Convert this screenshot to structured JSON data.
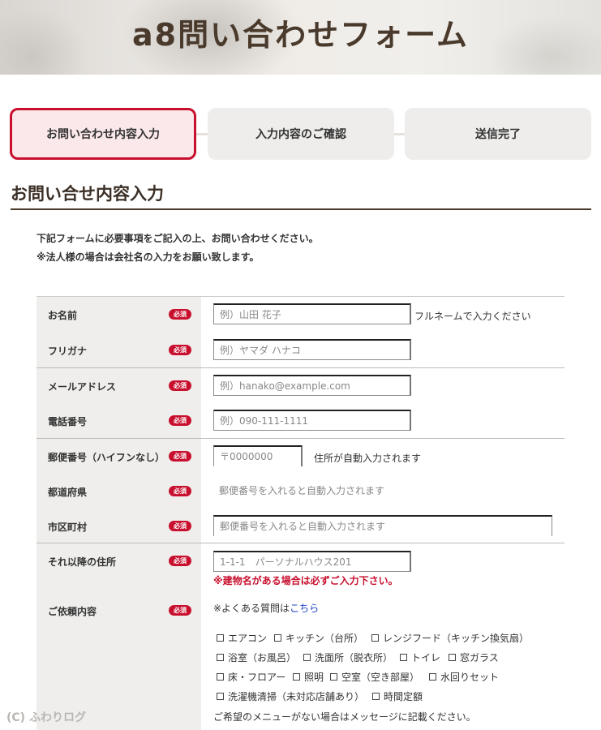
{
  "hero": {
    "title": "a8問い合わせフォーム"
  },
  "steps": [
    {
      "label": "お問い合わせ内容入力",
      "active": true
    },
    {
      "label": "入力内容のご確認",
      "active": false
    },
    {
      "label": "送信完了",
      "active": false
    }
  ],
  "section": {
    "title": "お問い合せ内容入力",
    "intro_line1": "下記フォームに必要事項をご記入の上、お問い合わせください。",
    "intro_line2": "※法人様の場合は会社名の入力をお願い致します。"
  },
  "required_badge": "必須",
  "fields": {
    "name": {
      "label": "お名前",
      "placeholder": "例）山田 花子",
      "note": "フルネームで入力ください"
    },
    "furigana": {
      "label": "フリガナ",
      "placeholder": "例）ヤマダ ハナコ"
    },
    "email": {
      "label": "メールアドレス",
      "placeholder": "例）hanako@example.com"
    },
    "phone": {
      "label": "電話番号",
      "placeholder": "例）090-111-1111"
    },
    "postal": {
      "label": "郵便番号（ハイフンなし）",
      "placeholder": "〒0000000",
      "note": "住所が自動入力されます"
    },
    "prefecture": {
      "label": "都道府県",
      "placeholder": "郵便番号を入れると自動入力されます"
    },
    "city": {
      "label": "市区町村",
      "placeholder": "郵便番号を入れると自動入力されます"
    },
    "address": {
      "label": "それ以降の住所",
      "placeholder": "1-1-1　パーソナルハウス201",
      "warning": "※建物名がある場合は必ずご入力下さい。"
    },
    "request": {
      "label": "ご依頼内容",
      "faq_prefix": "※よくある質問は",
      "faq_link": "こちら",
      "options": [
        [
          "エアコン",
          "キッチン（台所）",
          "レンジフード（キッチン換気扇）"
        ],
        [
          "浴室（お風呂）",
          "洗面所（脱衣所）",
          "トイレ",
          "窓ガラス"
        ],
        [
          "床・フロアー",
          "照明",
          "空室（空き部屋）",
          "水回りセット"
        ],
        [
          "洗濯機清掃（未対応店舗あり）",
          "時間定額"
        ]
      ],
      "footnote": "ご希望のメニューがない場合はメッセージに記載ください。"
    }
  },
  "credit": "(C) ふわりログ"
}
